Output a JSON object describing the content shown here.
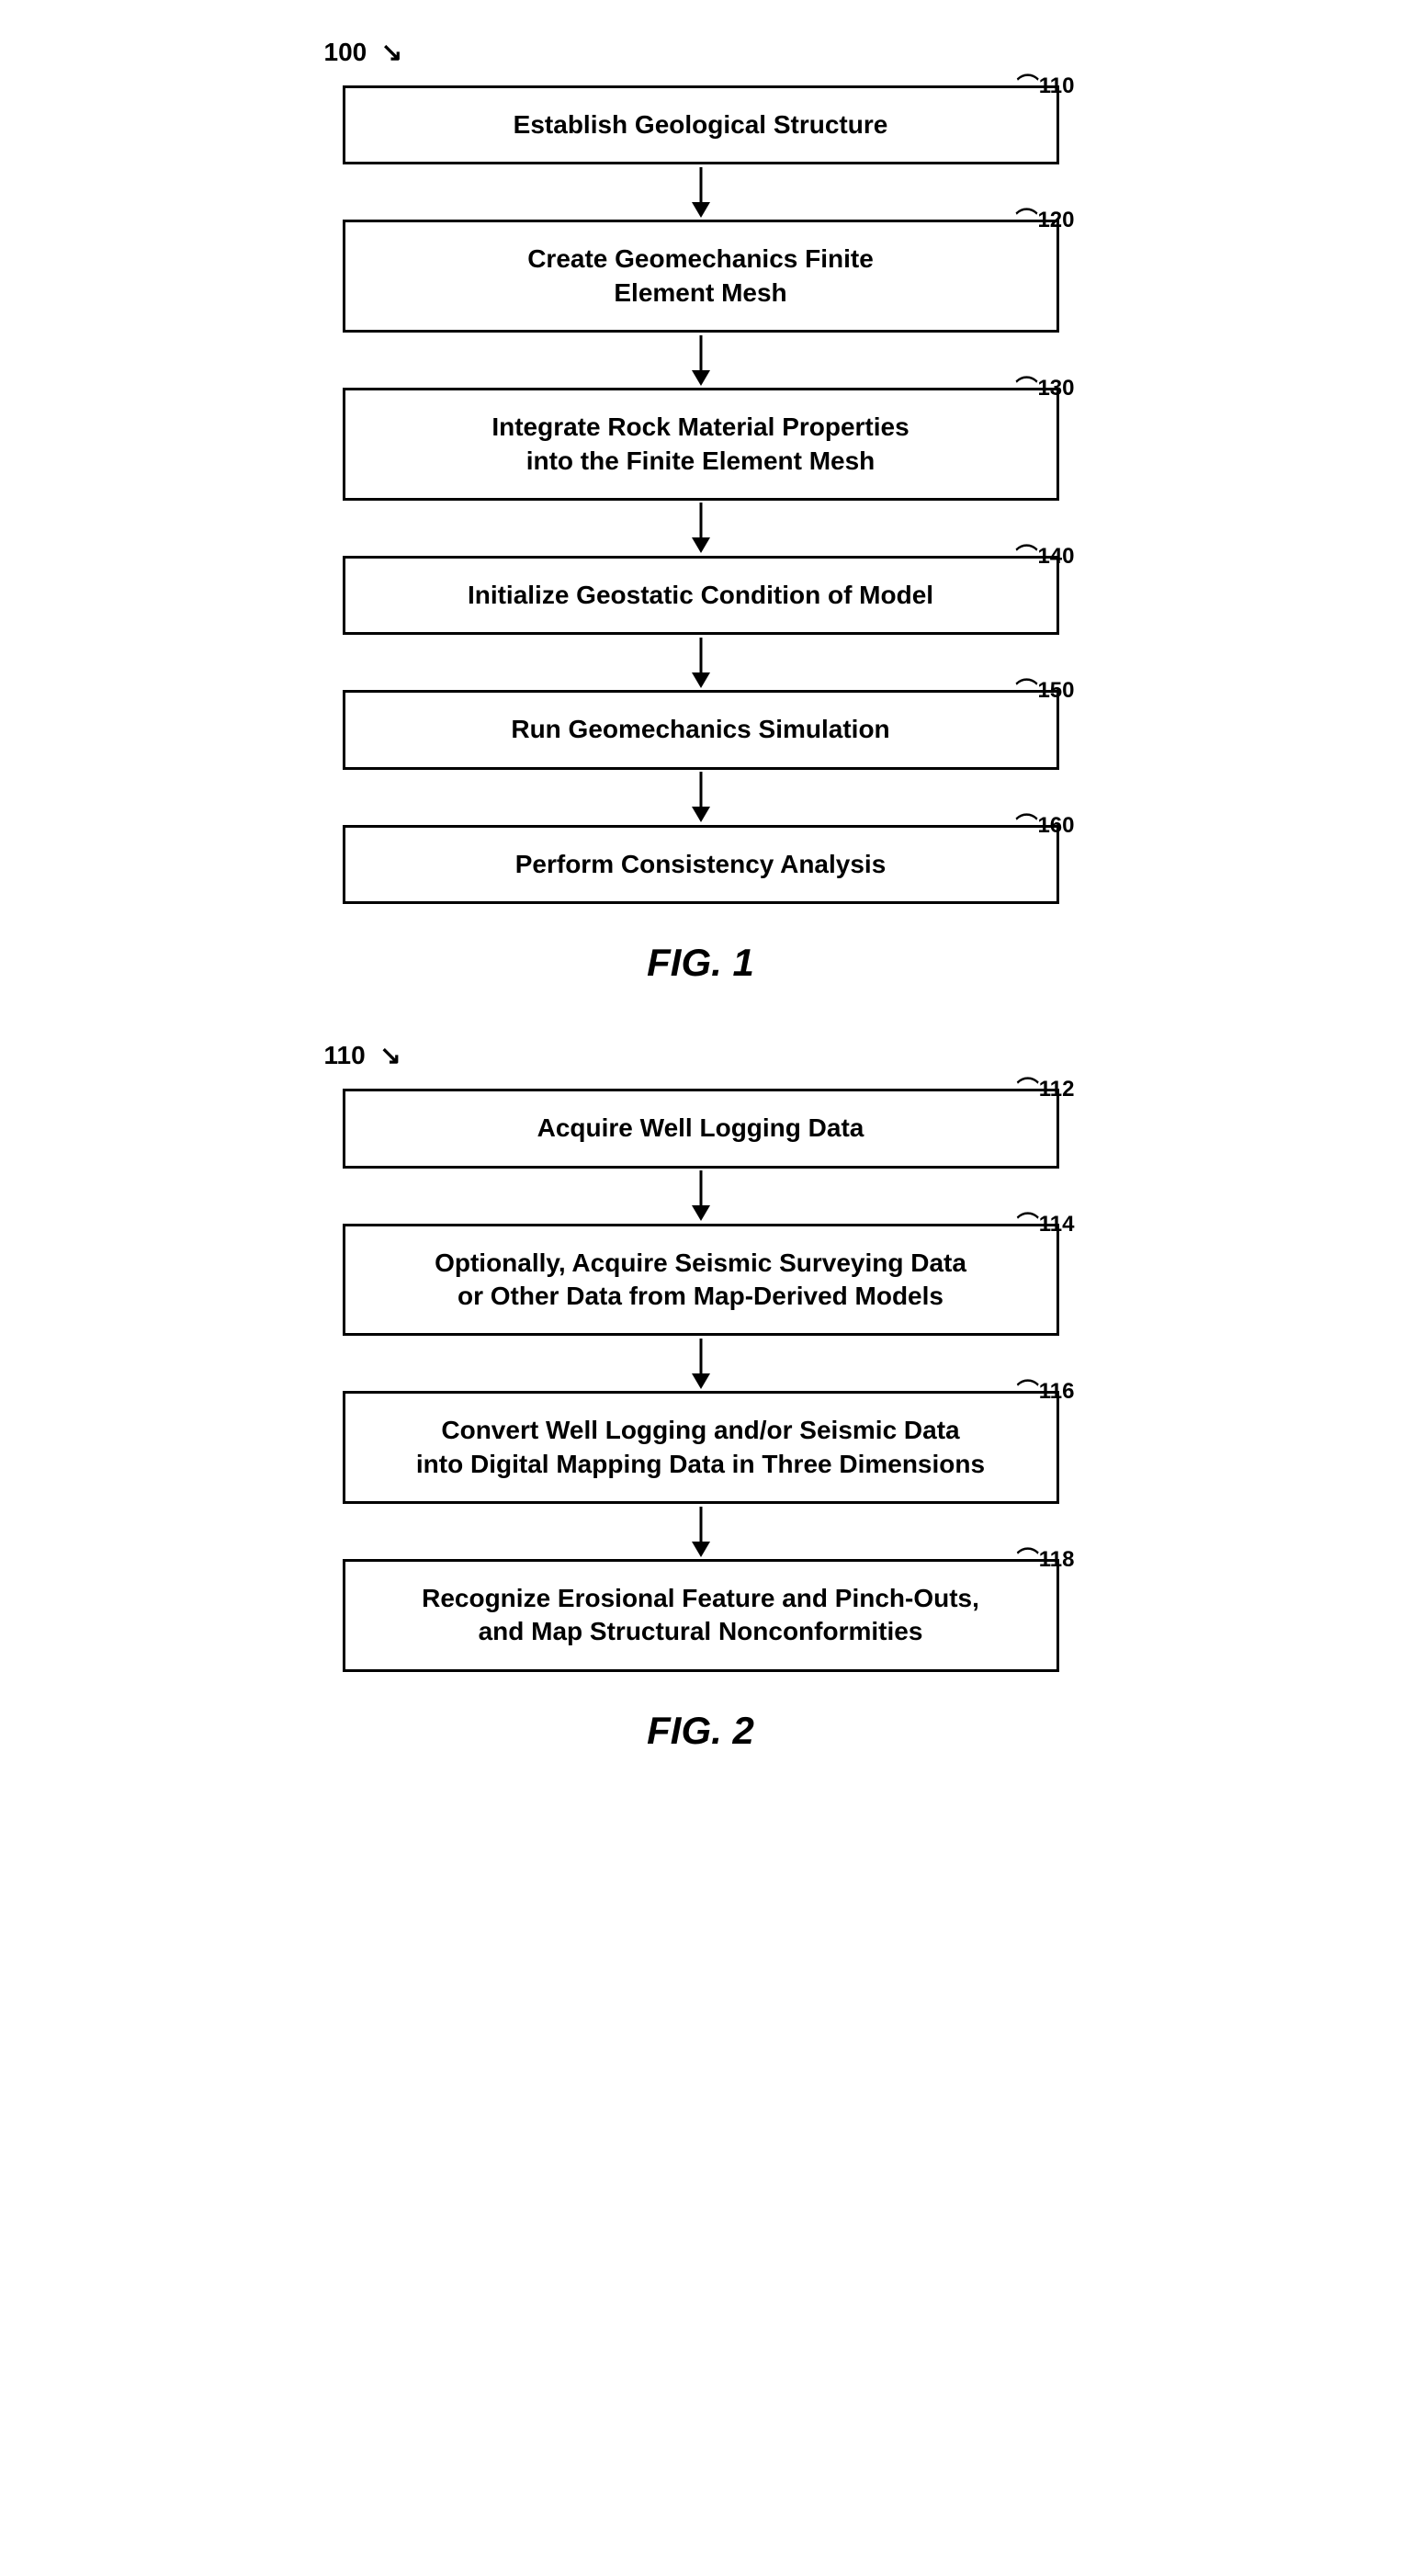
{
  "fig1": {
    "top_ref": "100",
    "top_ref_arrow": "↘",
    "label": "FIG. 1",
    "boxes": [
      {
        "id": "box110",
        "ref": "110",
        "text": "Establish Geological Structure"
      },
      {
        "id": "box120",
        "ref": "120",
        "text": "Create Geomechanics Finite\nElement Mesh"
      },
      {
        "id": "box130",
        "ref": "130",
        "text": "Integrate Rock Material Properties\ninto the Finite Element Mesh"
      },
      {
        "id": "box140",
        "ref": "140",
        "text": "Initialize Geostatic Condition of Model"
      },
      {
        "id": "box150",
        "ref": "150",
        "text": "Run Geomechanics Simulation"
      },
      {
        "id": "box160",
        "ref": "160",
        "text": "Perform Consistency Analysis"
      }
    ]
  },
  "fig2": {
    "top_ref": "110",
    "top_ref_arrow": "↘",
    "label": "FIG. 2",
    "boxes": [
      {
        "id": "box112",
        "ref": "112",
        "text": "Acquire Well Logging Data"
      },
      {
        "id": "box114",
        "ref": "114",
        "text": "Optionally, Acquire Seismic Surveying Data\nor Other Data from Map-Derived Models"
      },
      {
        "id": "box116",
        "ref": "116",
        "text": "Convert Well Logging and/or Seismic Data\ninto Digital Mapping Data in Three Dimensions"
      },
      {
        "id": "box118",
        "ref": "118",
        "text": "Recognize Erosional Feature and Pinch-Outs,\nand Map Structural Nonconformities"
      }
    ]
  }
}
